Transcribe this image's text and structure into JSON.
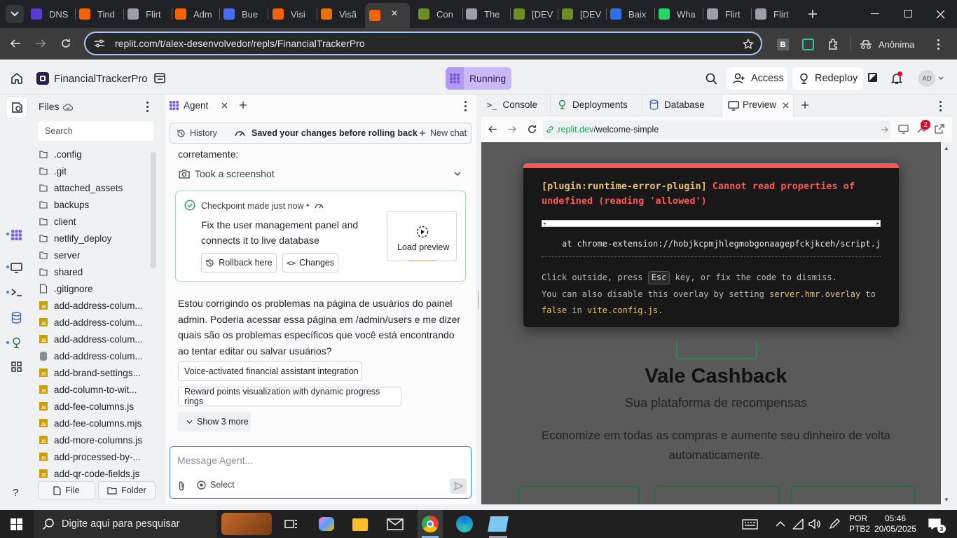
{
  "browser": {
    "tabs": [
      {
        "label": "DNS",
        "color": "#5b3bd6"
      },
      {
        "label": "Tind",
        "color": "#f26207"
      },
      {
        "label": "Flirt",
        "color": "#9aa0a6"
      },
      {
        "label": "Adm",
        "color": "#f26207"
      },
      {
        "label": "Bue",
        "color": "#4b6bfb"
      },
      {
        "label": "Visi",
        "color": "#f26207"
      },
      {
        "label": "Visã",
        "color": "#e8710a"
      },
      {
        "label": "",
        "color": "#f26207"
      },
      {
        "label": "Con",
        "color": "#6a8e23"
      },
      {
        "label": "The",
        "color": "#9aa0a6"
      },
      {
        "label": "[DEV",
        "color": "#6a8e23"
      },
      {
        "label": "[DEV",
        "color": "#6a8e23"
      },
      {
        "label": "Baix",
        "color": "#2f6fe4"
      },
      {
        "label": "Wha",
        "color": "#25d366"
      },
      {
        "label": "Flirt",
        "color": "#9aa0a6"
      },
      {
        "label": "Flirt",
        "color": "#9aa0a6"
      }
    ],
    "url": "replit.com/t/alex-desenvolvedor/repls/FinancialTrackerPro",
    "profile_label": "Anônima",
    "ext_badge": "B"
  },
  "replit": {
    "project_name": "FinancialTrackerPro",
    "status": "Running",
    "access_label": "Access",
    "redeploy_label": "Redeploy",
    "avatar": "AD"
  },
  "files": {
    "title": "Files",
    "search_placeholder": "Search",
    "items": [
      {
        "name": ".config",
        "type": "folder"
      },
      {
        "name": ".git",
        "type": "folder"
      },
      {
        "name": "attached_assets",
        "type": "folder"
      },
      {
        "name": "backups",
        "type": "folder"
      },
      {
        "name": "client",
        "type": "folder"
      },
      {
        "name": "netlify_deploy",
        "type": "folder"
      },
      {
        "name": "server",
        "type": "folder"
      },
      {
        "name": "shared",
        "type": "folder"
      },
      {
        "name": ".gitignore",
        "type": "file"
      },
      {
        "name": "add-address-colum...",
        "type": "js"
      },
      {
        "name": "add-address-colum...",
        "type": "js"
      },
      {
        "name": "add-address-colum...",
        "type": "js"
      },
      {
        "name": "add-address-colum...",
        "type": "db"
      },
      {
        "name": "add-brand-settings...",
        "type": "js"
      },
      {
        "name": "add-column-to-wit...",
        "type": "js"
      },
      {
        "name": "add-fee-columns.js",
        "type": "js"
      },
      {
        "name": "add-fee-columns.mjs",
        "type": "js"
      },
      {
        "name": "add-more-columns.js",
        "type": "js"
      },
      {
        "name": "add-processed-by-...",
        "type": "js"
      },
      {
        "name": "add-qr-code-fields.js",
        "type": "js"
      }
    ],
    "file_button": "File",
    "folder_button": "Folder"
  },
  "agent": {
    "tab_label": "Agent",
    "history_label": "History",
    "saved_notice": "Saved your changes before rolling back",
    "new_chat_label": "New chat",
    "partial_text": "corretamente:",
    "screenshot_label": "Took a screenshot",
    "checkpoint_label": "Checkpoint made just now",
    "checkpoint_desc": "Fix the user management panel and connects it to live database",
    "load_preview": "Load preview",
    "rollback_label": "Rollback here",
    "changes_label": "Changes",
    "message": "Estou corrigindo os problemas na página de usuários do painel admin. Poderia acessar essa página em /admin/users e me dizer quais são os problemas específicos que você está encontrando ao tentar editar ou salvar usuários?",
    "suggestions": [
      "Voice-activated financial assistant integration",
      "Reward points visualization with dynamic progress rings"
    ],
    "show_more": "Show 3 more",
    "input_placeholder": "Message Agent...",
    "select_label": "Select"
  },
  "panes": {
    "tabs": [
      "Console",
      "Deployments",
      "Database",
      "Preview"
    ]
  },
  "preview": {
    "url_host": ".replit.dev",
    "url_path": "/welcome-simple",
    "badge": "2",
    "error_plugin": "[plugin:runtime-error-plugin]",
    "error_message": "Cannot read properties of undefined (reading 'allowed')",
    "stack_line": "at chrome-extension://hobjkcpmjhlegmobgonaagepfckjkceh/script.js",
    "dismiss_text_1": "Click outside, press",
    "dismiss_key": "Esc",
    "dismiss_text_2": "key, or fix the code to dismiss.",
    "disable_text_1": "You can also disable this overlay by setting",
    "disable_setting": "server.hmr.overlay",
    "disable_text_2": "to",
    "disable_value": "false",
    "disable_text_3": "in",
    "disable_file": "vite.config.js.",
    "page_title": "Vale Cashback",
    "page_subtitle": "Sua plataforma de recompensas",
    "page_desc": "Economize em todas as compras e aumente seu dinheiro de volta automaticamente."
  },
  "taskbar": {
    "search_placeholder": "Digite aqui para pesquisar",
    "lang_1": "POR",
    "lang_2": "PTB2",
    "time": "05:46",
    "date": "20/05/2025"
  },
  "colors": {
    "replit_orange": "#f26207",
    "status_purple": "#c9b8f5",
    "error_red": "#ff5555",
    "error_yellow": "#e8c070",
    "overlay_bg": "#181818"
  }
}
